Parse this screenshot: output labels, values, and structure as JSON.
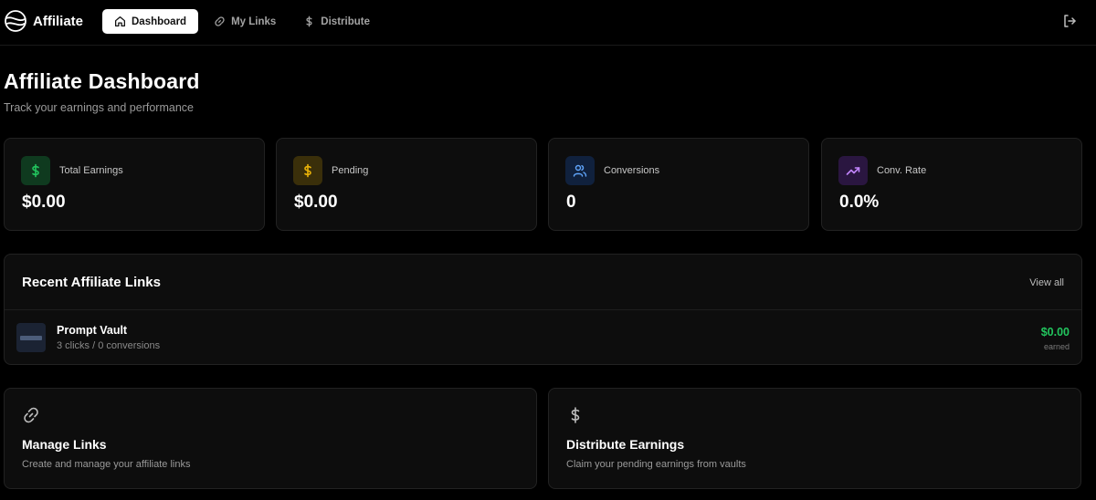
{
  "brand": {
    "name": "Affiliate"
  },
  "nav": {
    "items": [
      {
        "label": "Dashboard",
        "icon": "home-icon",
        "active": true
      },
      {
        "label": "My Links",
        "icon": "link-icon",
        "active": false
      },
      {
        "label": "Distribute",
        "icon": "dollar-icon",
        "active": false
      }
    ],
    "logout_icon": "logout-icon"
  },
  "header": {
    "title": "Affiliate Dashboard",
    "subtitle": "Track your earnings and performance"
  },
  "stats": [
    {
      "label": "Total Earnings",
      "value": "$0.00",
      "icon": "dollar-icon",
      "color": "#22c55e",
      "bg": "#0f3a1f"
    },
    {
      "label": "Pending",
      "value": "$0.00",
      "icon": "dollar-icon",
      "color": "#eab308",
      "bg": "#3a2f0a"
    },
    {
      "label": "Conversions",
      "value": "0",
      "icon": "users-icon",
      "color": "#60a5fa",
      "bg": "#10213d"
    },
    {
      "label": "Conv. Rate",
      "value": "0.0%",
      "icon": "trending-up-icon",
      "color": "#c084fc",
      "bg": "#2a1640"
    }
  ],
  "recent_links": {
    "title": "Recent Affiliate Links",
    "view_all": "View all",
    "items": [
      {
        "name": "Prompt Vault",
        "meta": "3 clicks / 0 conversions",
        "earned": "$0.00",
        "earned_label": "earned"
      }
    ]
  },
  "actions": [
    {
      "title": "Manage Links",
      "description": "Create and manage your affiliate links",
      "icon": "link-icon"
    },
    {
      "title": "Distribute Earnings",
      "description": "Claim your pending earnings from vaults",
      "icon": "dollar-icon"
    }
  ]
}
